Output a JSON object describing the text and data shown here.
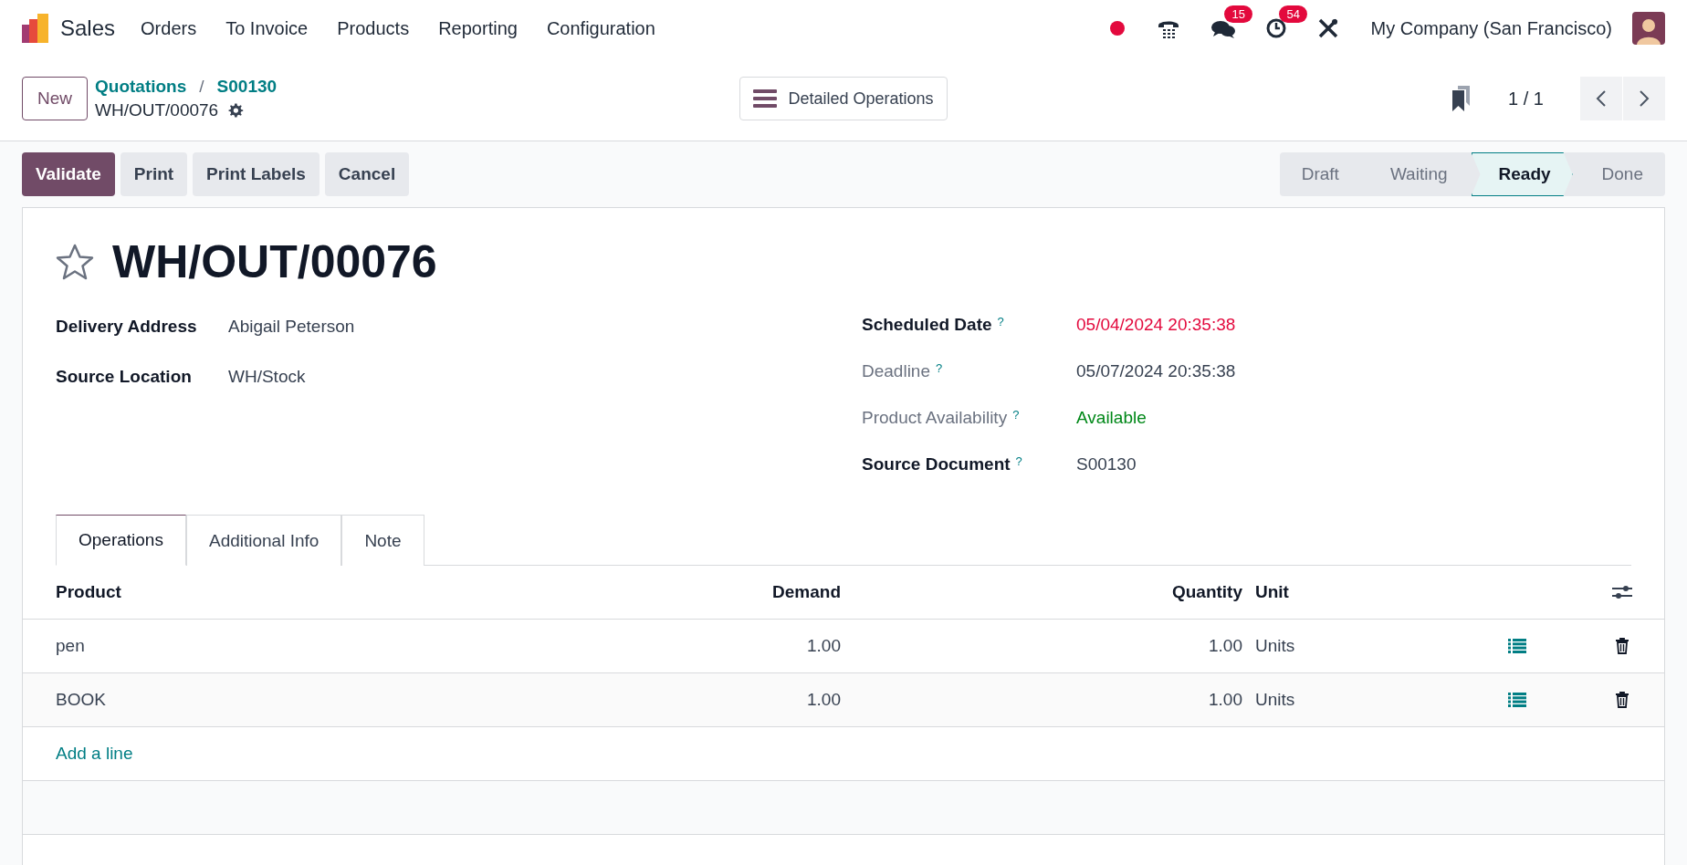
{
  "navbar": {
    "app_name": "Sales",
    "menu": [
      "Orders",
      "To Invoice",
      "Products",
      "Reporting",
      "Configuration"
    ],
    "systray": [
      {
        "kind": "record"
      },
      {
        "kind": "phone"
      },
      {
        "kind": "messages",
        "badge": "15"
      },
      {
        "kind": "activity",
        "badge": "54"
      },
      {
        "kind": "tools"
      }
    ],
    "company": "My Company (San Francisco)"
  },
  "control_panel": {
    "new_button": "New",
    "breadcrumbs": [
      "Quotations",
      "S00130"
    ],
    "separator": "/",
    "record_name": "WH/OUT/00076",
    "action_button": "Detailed Operations",
    "pager": "1 / 1"
  },
  "buttons": [
    {
      "label": "Validate",
      "kind": "primary"
    },
    {
      "label": "Print",
      "kind": "secondary"
    },
    {
      "label": "Print Labels",
      "kind": "secondary"
    },
    {
      "label": "Cancel",
      "kind": "secondary"
    }
  ],
  "stages": [
    {
      "label": "Draft",
      "selected": false
    },
    {
      "label": "Waiting",
      "selected": false
    },
    {
      "label": "Ready",
      "selected": true
    },
    {
      "label": "Done",
      "selected": false
    }
  ],
  "form": {
    "title": "WH/OUT/00076",
    "starred": false,
    "left_fields": [
      {
        "label": "Delivery Address",
        "value": "Abigail Peterson",
        "muted": false,
        "color": "#374151"
      },
      {
        "label": "Source Location",
        "value": "WH/Stock",
        "muted": false,
        "color": "#374151"
      }
    ],
    "right_fields": [
      {
        "label": "Scheduled Date",
        "help": "?",
        "value": "05/04/2024 20:35:38",
        "muted": false,
        "color": "#e3093d"
      },
      {
        "label": "Deadline",
        "help": "?",
        "value": "05/07/2024 20:35:38",
        "muted": true,
        "color": "#374151"
      },
      {
        "label": "Product Availability",
        "help": "?",
        "value": "Available",
        "muted": true,
        "color": "#008818"
      },
      {
        "label": "Source Document",
        "help": "?",
        "value": "S00130",
        "muted": false,
        "color": "#374151"
      }
    ]
  },
  "tabs": [
    {
      "label": "Operations",
      "selected": true
    },
    {
      "label": "Additional Info",
      "selected": false
    },
    {
      "label": "Note",
      "selected": false
    }
  ],
  "table": {
    "columns": [
      "Product",
      "Demand",
      "Quantity",
      "Unit"
    ],
    "rows": [
      {
        "product": "pen",
        "demand": "1.00",
        "quantity": "1.00",
        "unit": "Units"
      },
      {
        "product": "BOOK",
        "demand": "1.00",
        "quantity": "1.00",
        "unit": "Units"
      }
    ],
    "add_line": "Add a line"
  }
}
